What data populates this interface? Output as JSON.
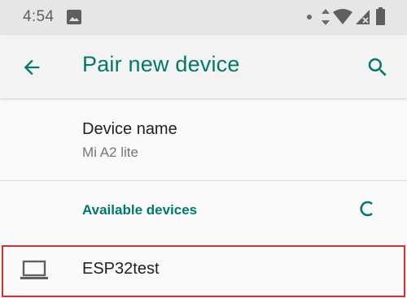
{
  "status_bar": {
    "time": "4:54",
    "icons": [
      "gallery-icon",
      "dot-icon",
      "data-transfer-icon",
      "wifi-icon",
      "cellular-no-signal-icon",
      "battery-icon"
    ]
  },
  "app_bar": {
    "title": "Pair new device",
    "back_icon": "arrow-back-icon",
    "search_icon": "search-icon"
  },
  "device_name": {
    "title": "Device name",
    "value": "Mi A2 lite"
  },
  "available_devices": {
    "header": "Available devices",
    "progress_icon": "refresh-progress-icon",
    "items": [
      {
        "label": "ESP32test",
        "icon": "laptop-icon"
      }
    ]
  },
  "colors": {
    "accent": "#00796b",
    "status_bar_bg": "#e6e6e6",
    "app_bar_bg": "#f3f3f3",
    "highlight_border": "#d32f2f"
  }
}
